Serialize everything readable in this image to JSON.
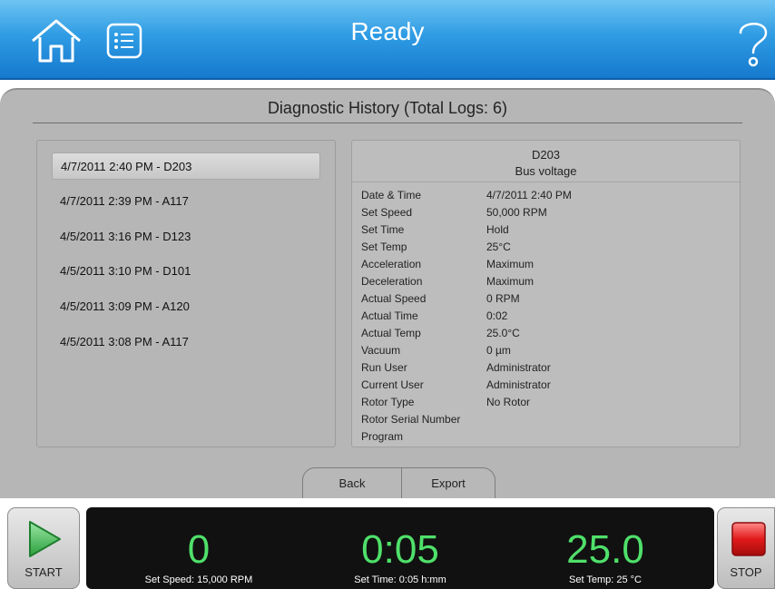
{
  "header": {
    "title": "Ready",
    "home_icon": "home-icon",
    "log_icon": "list-icon",
    "help_icon": "question-icon",
    "colors": {
      "top": "#6ec4f2",
      "bottom": "#1679cd"
    }
  },
  "panel": {
    "title": "Diagnostic History (Total Logs: 6)",
    "logs": [
      {
        "label": "4/7/2011 2:40 PM - D203",
        "selected": true
      },
      {
        "label": "4/7/2011 2:39 PM - A117",
        "selected": false
      },
      {
        "label": "4/5/2011 3:16 PM - D123",
        "selected": false
      },
      {
        "label": "4/5/2011 3:10 PM - D101",
        "selected": false
      },
      {
        "label": "4/5/2011 3:09 PM - A120",
        "selected": false
      },
      {
        "label": "4/5/2011 3:08 PM - A117",
        "selected": false
      }
    ],
    "detail": {
      "code": "D203",
      "description": "Bus voltage",
      "rows": [
        {
          "key": "Date & Time",
          "value": "4/7/2011 2:40 PM"
        },
        {
          "key": "Set Speed",
          "value": "50,000 RPM"
        },
        {
          "key": "Set Time",
          "value": "Hold"
        },
        {
          "key": "Set Temp",
          "value": "25°C"
        },
        {
          "key": "Acceleration",
          "value": "Maximum"
        },
        {
          "key": "Deceleration",
          "value": "Maximum"
        },
        {
          "key": "Actual Speed",
          "value": "0 RPM"
        },
        {
          "key": "Actual Time",
          "value": "0:02"
        },
        {
          "key": "Actual Temp",
          "value": "25.0°C"
        },
        {
          "key": "Vacuum",
          "value": "0 µm"
        },
        {
          "key": "Run User",
          "value": "Administrator"
        },
        {
          "key": "Current User",
          "value": "Administrator"
        },
        {
          "key": "Rotor Type",
          "value": "No Rotor"
        },
        {
          "key": "Rotor Serial Number",
          "value": ""
        },
        {
          "key": "Program",
          "value": ""
        }
      ]
    },
    "tabs": {
      "back": "Back",
      "export": "Export"
    }
  },
  "controls": {
    "start_label": "START",
    "stop_label": "STOP",
    "speed_value": "0",
    "speed_set": "Set Speed: 15,000 RPM",
    "time_value": "0:05",
    "time_set": "Set Time: 0:05 h:mm",
    "temp_value": "25.0",
    "temp_set": "Set Temp: 25 °C",
    "accent": "#4fe06a",
    "stop_color": "#e11a1a"
  }
}
